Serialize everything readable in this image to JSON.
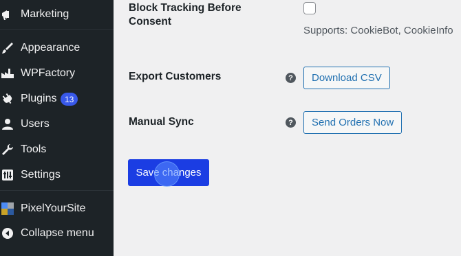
{
  "sidebar": {
    "items": [
      {
        "label": "Marketing",
        "icon": "megaphone-icon"
      },
      {
        "label": "Appearance",
        "icon": "paintbrush-icon"
      },
      {
        "label": "WPFactory",
        "icon": "factory-icon"
      },
      {
        "label": "Plugins",
        "icon": "plugin-icon",
        "badge": "13"
      },
      {
        "label": "Users",
        "icon": "user-icon"
      },
      {
        "label": "Tools",
        "icon": "wrench-icon"
      },
      {
        "label": "Settings",
        "icon": "settings-icon"
      },
      {
        "label": "PixelYourSite",
        "icon": "pixelyoursite-logo-icon"
      },
      {
        "label": "Collapse menu",
        "icon": "collapse-arrow-icon"
      }
    ]
  },
  "settings": {
    "block_tracking": {
      "label_line1": "Block Tracking Before",
      "label_line2": "Consent",
      "checked": false,
      "supports_text": "Supports: CookieBot, CookieInfo"
    },
    "export_customers": {
      "label": "Export Customers",
      "help": "?",
      "button": "Download CSV"
    },
    "manual_sync": {
      "label": "Manual Sync",
      "help": "?",
      "button": "Send Orders Now"
    },
    "save_button": "Save changes"
  },
  "colors": {
    "sidebar_bg": "#1d2327",
    "accent": "#2271b1",
    "primary_button": "#1b3de3",
    "badge": "#3858e9"
  }
}
